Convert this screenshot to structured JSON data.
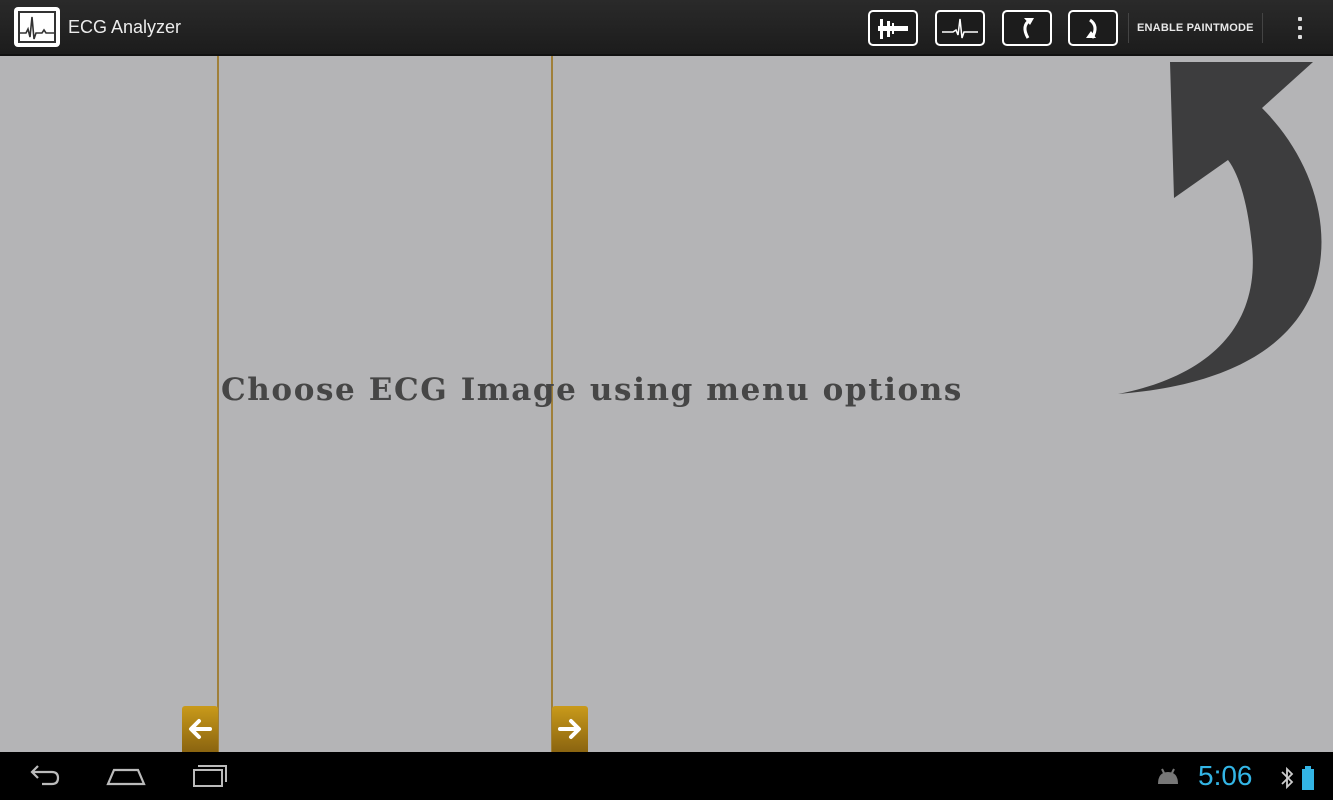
{
  "app": {
    "title": "ECG Analyzer"
  },
  "toolbar": {
    "paint_label": "ENABLE PAINTMODE",
    "buttons": [
      "caliper-icon",
      "ecg-trace-icon",
      "rotate-left-icon",
      "rotate-right-icon"
    ]
  },
  "canvas": {
    "hint": "Choose ECG Image using menu options",
    "cursor_color": "#a0803a",
    "handle_color": "#b98a16"
  },
  "system": {
    "clock": "5:06",
    "clock_color": "#33b5e5"
  }
}
